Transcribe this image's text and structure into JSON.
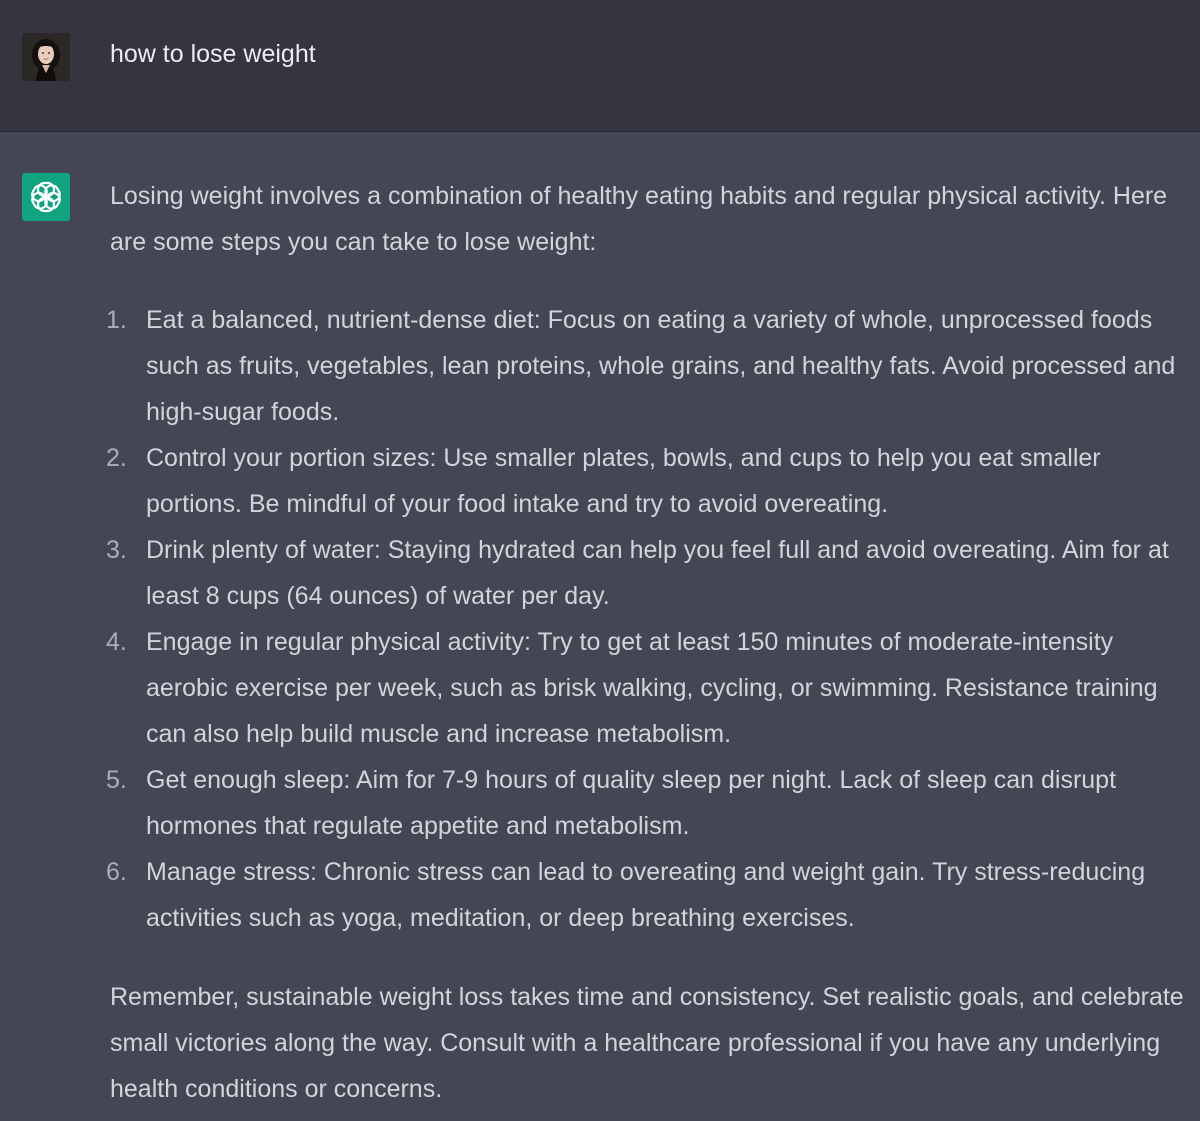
{
  "user": {
    "message": "how to lose weight"
  },
  "assistant": {
    "intro": "Losing weight involves a combination of healthy eating habits and regular physical activity. Here are some steps you can take to lose weight:",
    "steps": [
      {
        "number": "1.",
        "text": "Eat a balanced, nutrient-dense diet: Focus on eating a variety of whole, unprocessed foods such as fruits, vegetables, lean proteins, whole grains, and healthy fats. Avoid processed and high-sugar foods."
      },
      {
        "number": "2.",
        "text": "Control your portion sizes: Use smaller plates, bowls, and cups to help you eat smaller portions. Be mindful of your food intake and try to avoid overeating."
      },
      {
        "number": "3.",
        "text": "Drink plenty of water: Staying hydrated can help you feel full and avoid overeating. Aim for at least 8 cups (64 ounces) of water per day."
      },
      {
        "number": "4.",
        "text": "Engage in regular physical activity: Try to get at least 150 minutes of moderate-intensity aerobic exercise per week, such as brisk walking, cycling, or swimming. Resistance training can also help build muscle and increase metabolism."
      },
      {
        "number": "5.",
        "text": "Get enough sleep: Aim for 7-9 hours of quality sleep per night. Lack of sleep can disrupt hormones that regulate appetite and metabolism."
      },
      {
        "number": "6.",
        "text": "Manage stress: Chronic stress can lead to overeating and weight gain. Try stress-reducing activities such as yoga, meditation, or deep breathing exercises."
      }
    ],
    "closing": "Remember, sustainable weight loss takes time and consistency. Set realistic goals, and celebrate small victories along the way. Consult with a healthcare professional if you have any underlying health conditions or concerns."
  },
  "icons": {
    "user_avatar": "user-avatar-photo",
    "assistant_avatar": "openai-logo-icon"
  },
  "colors": {
    "user_row_bg": "#343541",
    "assistant_row_bg": "#444654",
    "assistant_icon_bg": "#10a37f",
    "user_text": "#ececf1",
    "assistant_text": "#d1d5db"
  }
}
